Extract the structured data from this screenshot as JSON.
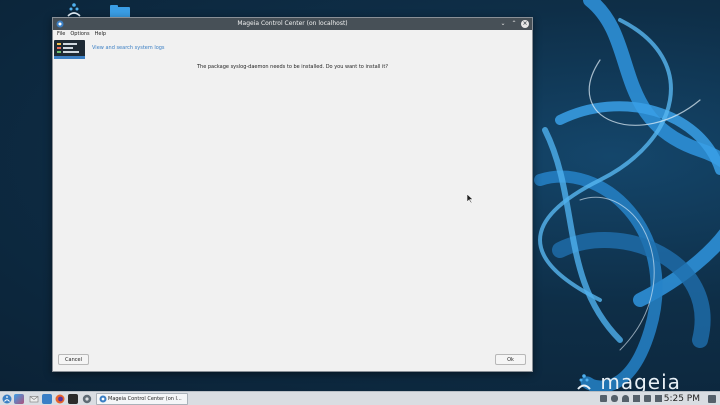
{
  "window": {
    "title": "Mageia Control Center  (on localhost)",
    "menu": [
      "File",
      "Options",
      "Help"
    ],
    "banner_link": "View and search system logs",
    "message": "The package syslog-daemon needs to be installed. Do you want to install it?",
    "cancel_label": "Cancel",
    "ok_label": "Ok"
  },
  "desktop": {
    "brand": "mageia"
  },
  "taskbar": {
    "task_label": "Mageia Control Center  (on l...",
    "clock": "5:25 PM"
  },
  "colors": {
    "accent": "#3b7fc4",
    "titlebar": "#475057",
    "wallpaper": "#0e2e47"
  },
  "icons": [
    "mageia-menu-icon",
    "desktop-icon",
    "mail-icon",
    "firefox-icon",
    "file-manager-icon",
    "terminal-icon",
    "settings-icon",
    "control-center-icon",
    "network-icon",
    "bluetooth-icon",
    "volume-icon",
    "battery-icon",
    "clipboard-icon",
    "show-desktop-icon"
  ]
}
